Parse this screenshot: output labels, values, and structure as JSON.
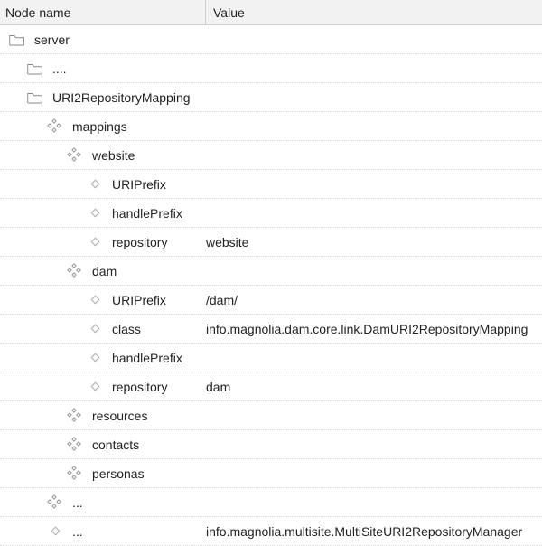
{
  "header": {
    "name": "Node name",
    "value": "Value"
  },
  "rows": [
    {
      "indent": 10,
      "icon": "folder",
      "label": "server",
      "value": ""
    },
    {
      "indent": 30,
      "icon": "folder",
      "label": "....",
      "value": ""
    },
    {
      "indent": 30,
      "icon": "folder",
      "label": "URI2RepositoryMapping",
      "value": ""
    },
    {
      "indent": 52,
      "icon": "content",
      "label": "mappings",
      "value": ""
    },
    {
      "indent": 74,
      "icon": "content",
      "label": "website",
      "value": ""
    },
    {
      "indent": 96,
      "icon": "prop",
      "label": "URIPrefix",
      "value": ""
    },
    {
      "indent": 96,
      "icon": "prop",
      "label": "handlePrefix",
      "value": ""
    },
    {
      "indent": 96,
      "icon": "prop",
      "label": "repository",
      "value": "website"
    },
    {
      "indent": 74,
      "icon": "content",
      "label": "dam",
      "value": ""
    },
    {
      "indent": 96,
      "icon": "prop",
      "label": "URIPrefix",
      "value": "/dam/"
    },
    {
      "indent": 96,
      "icon": "prop",
      "label": "class",
      "value": "info.magnolia.dam.core.link.DamURI2RepositoryMapping"
    },
    {
      "indent": 96,
      "icon": "prop",
      "label": "handlePrefix",
      "value": ""
    },
    {
      "indent": 96,
      "icon": "prop",
      "label": "repository",
      "value": "dam"
    },
    {
      "indent": 74,
      "icon": "content",
      "label": "resources",
      "value": ""
    },
    {
      "indent": 74,
      "icon": "content",
      "label": "contacts",
      "value": ""
    },
    {
      "indent": 74,
      "icon": "content",
      "label": "personas",
      "value": ""
    },
    {
      "indent": 52,
      "icon": "content",
      "label": "...",
      "value": ""
    },
    {
      "indent": 52,
      "icon": "prop",
      "label": "...",
      "value": "info.magnolia.multisite.MultiSiteURI2RepositoryManager"
    }
  ]
}
